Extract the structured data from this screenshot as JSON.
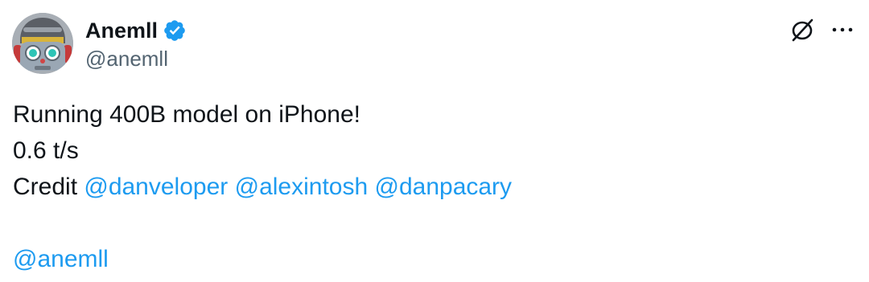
{
  "author": {
    "display_name": "Anemll",
    "handle": "@anemll",
    "verified": true
  },
  "icons": {
    "avatar": "robot-avatar",
    "verified": "verified-badge-icon",
    "grok": "grok-icon",
    "more": "more-options-icon"
  },
  "colors": {
    "link": "#1d9bf0",
    "text": "#0f1419",
    "secondary": "#536471",
    "verified": "#1d9bf0"
  },
  "tweet": {
    "line1": "Running 400B model on iPhone!",
    "line2": "0.6 t/s",
    "credit_label": "Credit ",
    "mentions": [
      "@danveloper",
      "@alexintosh",
      "@danpacary"
    ],
    "footer_mention": "@anemll"
  }
}
